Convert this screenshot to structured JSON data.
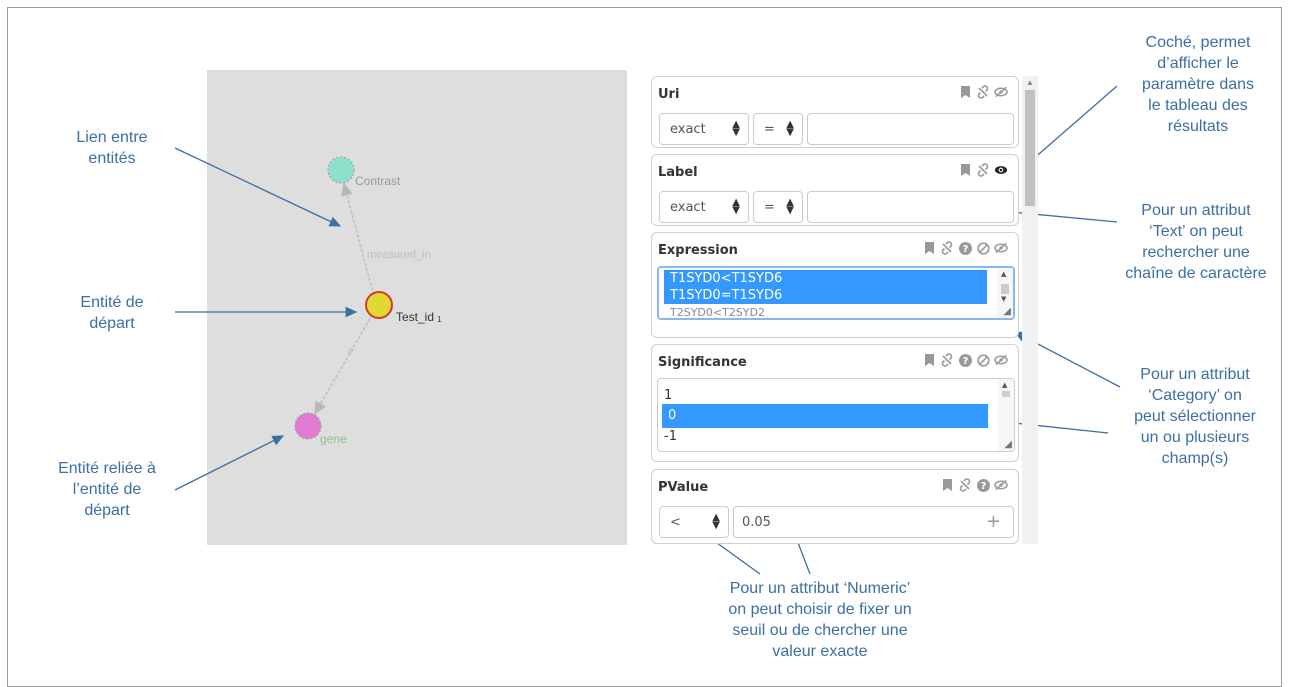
{
  "annotations": {
    "link": [
      "Lien entre",
      "entités"
    ],
    "start": [
      "Entité de",
      "départ"
    ],
    "related": [
      "Entité reliée à",
      "l’entité de",
      "départ"
    ],
    "checked": [
      "Coché, permet",
      "d’afficher le",
      "paramètre dans",
      "le tableau des",
      "résultats"
    ],
    "text_attr": [
      "Pour un attribut",
      "‘Text’ on peut",
      "rechercher une",
      "chaîne de caractère"
    ],
    "category_attr": [
      "Pour un attribut",
      "‘Category’ on",
      "peut sélectionner",
      "un ou plusieurs",
      "champ(s)"
    ],
    "numeric_attr": [
      "Pour un attribut ‘Numeric’",
      "on peut choisir de fixer un",
      "seuil ou de chercher une",
      "valeur exacte"
    ]
  },
  "graph": {
    "nodes": {
      "contrast": "Contrast",
      "test": "Test_id",
      "test_subscript": "1",
      "gene": "gene"
    },
    "edges": {
      "measured_in": "measured_in",
      "is": "is"
    },
    "colors": {
      "contrast": "#8de0cc",
      "test_fill": "#e3d833",
      "test_border": "#d23a2a",
      "gene": "#e27ad3"
    }
  },
  "panel": {
    "uri": {
      "title": "Uri",
      "match": "exact",
      "op": "=",
      "value": ""
    },
    "label": {
      "title": "Label",
      "match": "exact",
      "op": "=",
      "value": ""
    },
    "expression": {
      "title": "Expression",
      "options": [
        "T1SYD0<T1SYD6",
        "T1SYD0=T1SYD6",
        "T2SYD0<T2SYD2"
      ]
    },
    "significance": {
      "title": "Significance",
      "options": [
        "1",
        "0",
        "-1"
      ]
    },
    "pvalue": {
      "title": "PValue",
      "op": "<",
      "value": "0.05",
      "add": "+"
    }
  },
  "colors": {
    "annotation": "#3b6ea5",
    "selected": "#3399ff"
  }
}
